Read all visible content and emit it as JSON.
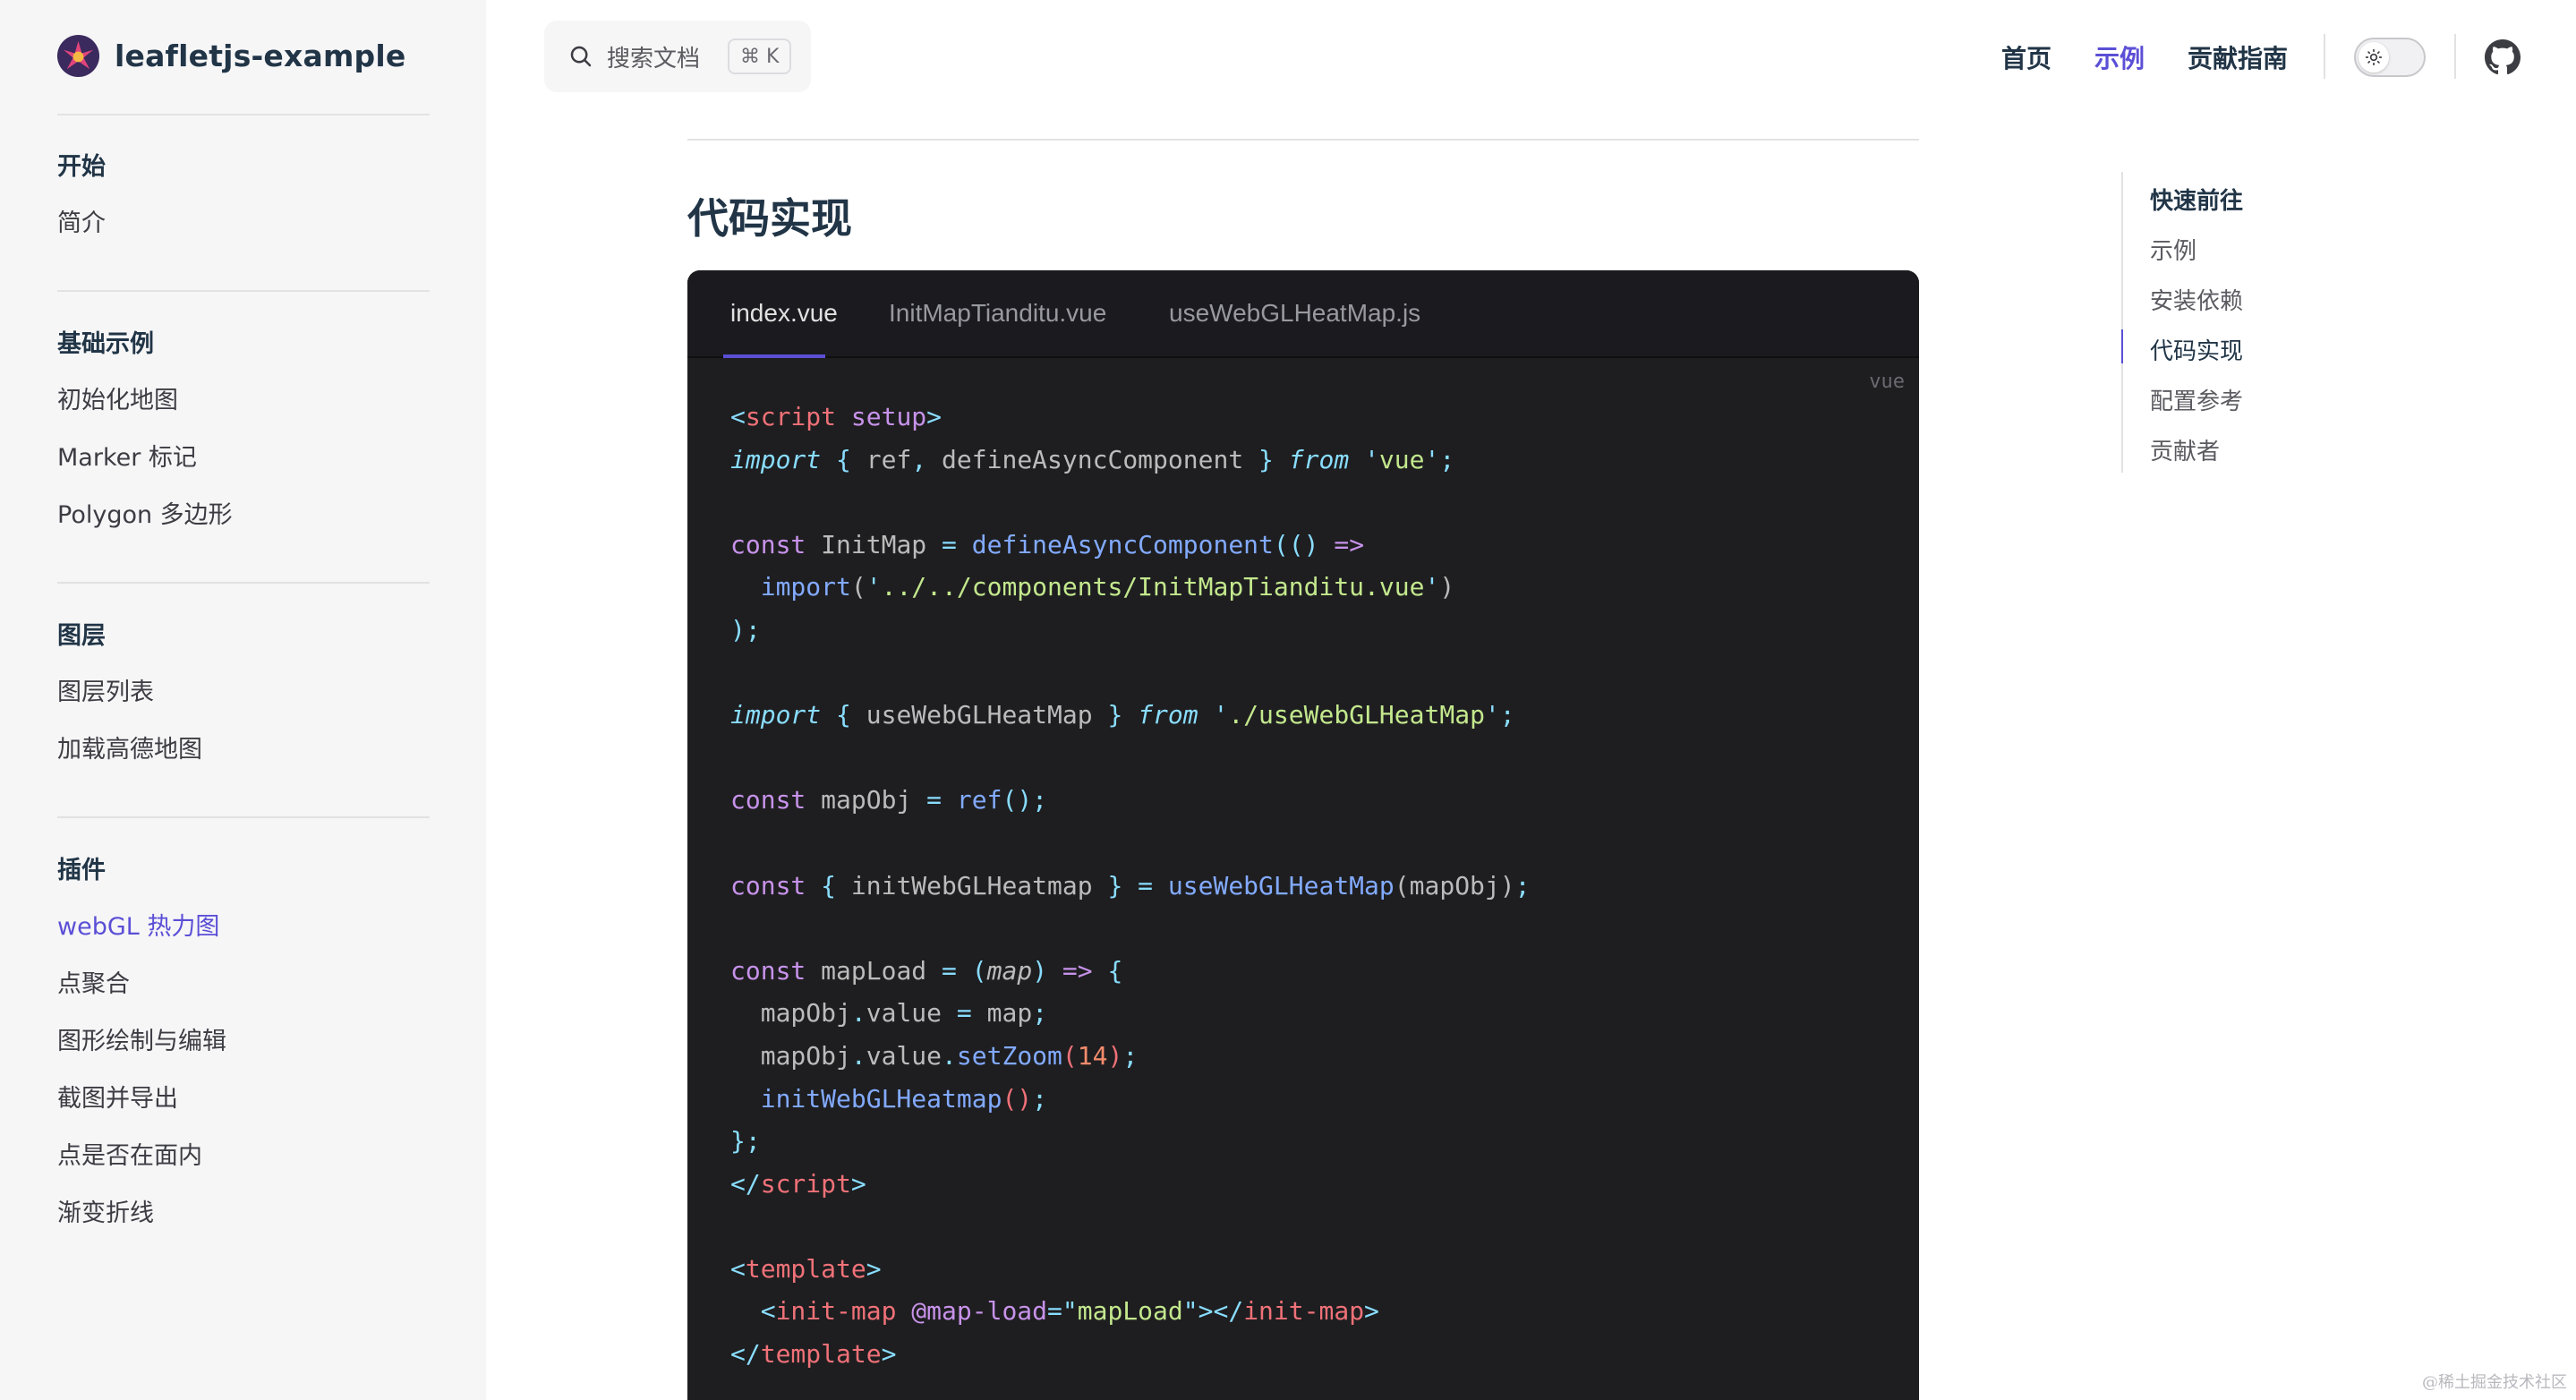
{
  "brand": {
    "title": "leafletjs-example"
  },
  "search": {
    "label": "搜索文档",
    "shortcut": "⌘ K"
  },
  "nav": {
    "home": "首页",
    "examples": "示例",
    "guide": "贡献指南"
  },
  "sidebar": {
    "groups": [
      {
        "title": "开始",
        "items": [
          "简介"
        ]
      },
      {
        "title": "基础示例",
        "items": [
          "初始化地图",
          "Marker 标记",
          "Polygon 多边形"
        ]
      },
      {
        "title": "图层",
        "items": [
          "图层列表",
          "加载高德地图"
        ]
      },
      {
        "title": "插件",
        "items": [
          "webGL 热力图",
          "点聚合",
          "图形绘制与编辑",
          "截图并导出",
          "点是否在面内",
          "渐变折线"
        ]
      }
    ],
    "active_item": "webGL 热力图"
  },
  "main": {
    "section_title": "代码实现",
    "code": {
      "tabs": [
        "index.vue",
        "InitMapTianditu.vue",
        "useWebGLHeatMap.js"
      ],
      "active_tab": "index.vue",
      "lang": "vue"
    }
  },
  "outline": {
    "title": "快速前往",
    "items": [
      "示例",
      "安装依赖",
      "代码实现",
      "配置参考",
      "贡献者"
    ],
    "active": "代码实现"
  },
  "watermark": "@稀土掘金技术社区",
  "colors": {
    "accent": "#5b4fd6",
    "code_bg": "#1e1e20",
    "sidebar_bg": "#f6f6f7"
  }
}
